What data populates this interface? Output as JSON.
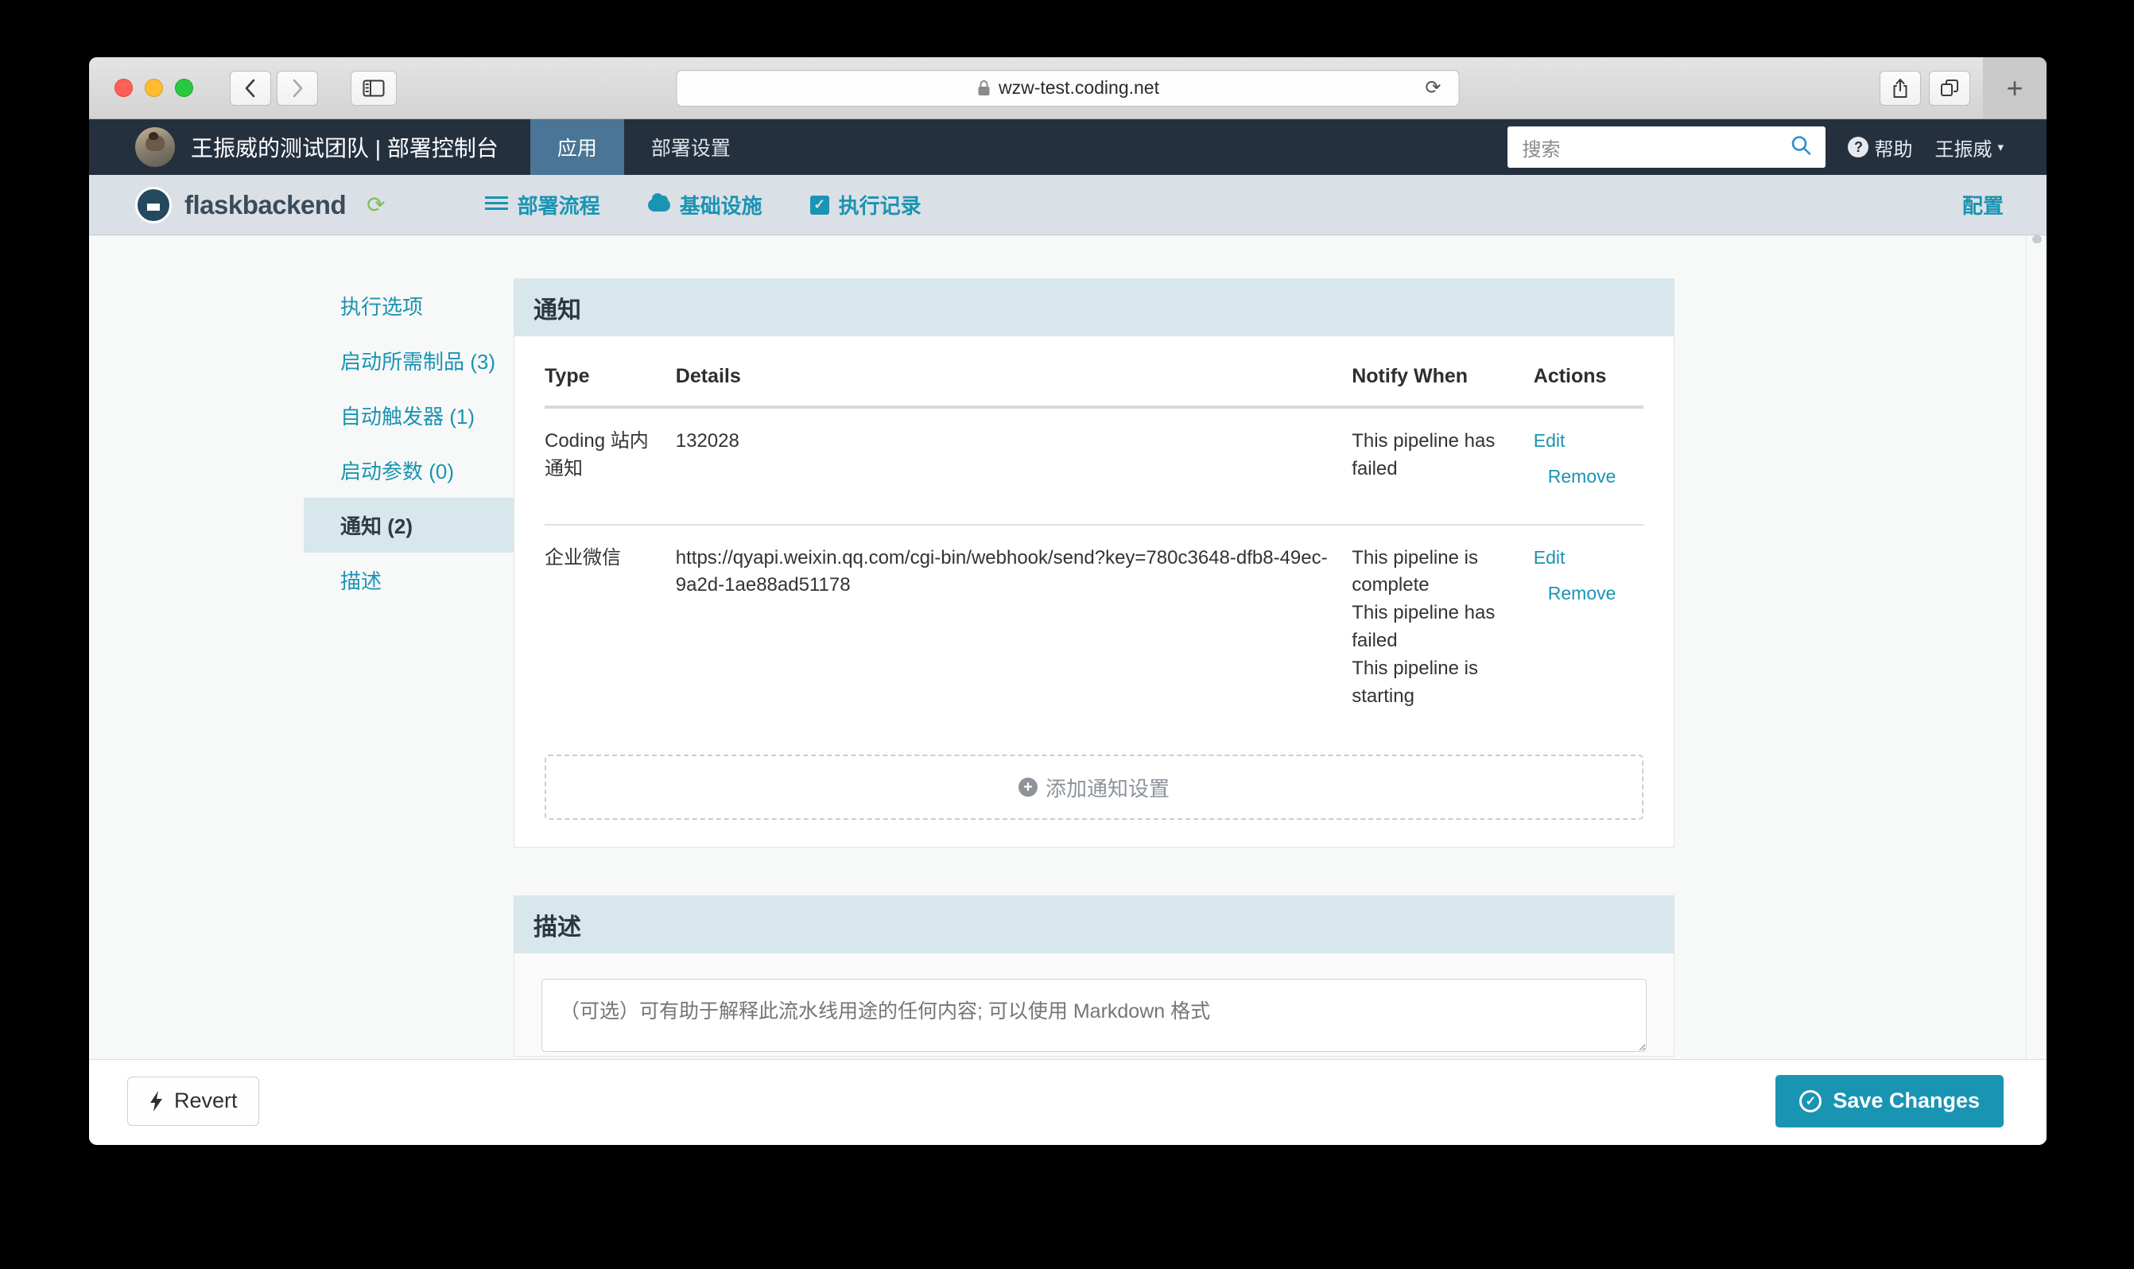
{
  "browser": {
    "url": "wzw-test.coding.net",
    "lock_icon": "lock-icon",
    "back_icon": "chevron-left-icon",
    "forward_icon": "chevron-right-icon",
    "sidebar_icon": "sidebar-toggle-icon",
    "reload_icon": "reload-icon",
    "share_icon": "share-icon",
    "tabs_icon": "tab-overview-icon",
    "newtab_label": "+"
  },
  "topnav": {
    "team_title": "王振威的测试团队 | 部署控制台",
    "items": [
      {
        "label": "应用",
        "active": true
      },
      {
        "label": "部署设置",
        "active": false
      }
    ],
    "search_placeholder": "搜索",
    "search_icon": "search-icon",
    "help_label": "帮助",
    "help_icon": "question-circle-icon",
    "user_label": "王振威",
    "user_caret": "▾",
    "avatar_icon": "avatar"
  },
  "appbar": {
    "app_name": "flaskbackend",
    "sync_icon": "refresh-icon",
    "logo_icon": "app-logo-icon",
    "tabs": [
      {
        "label": "部署流程",
        "icon": "list-icon"
      },
      {
        "label": "基础设施",
        "icon": "cloud-icon"
      },
      {
        "label": "执行记录",
        "icon": "checkbox-icon"
      }
    ],
    "config_label": "配置"
  },
  "sidebar": {
    "items": [
      {
        "label": "执行选项",
        "active": false
      },
      {
        "label": "启动所需制品 (3)",
        "active": false
      },
      {
        "label": "自动触发器 (1)",
        "active": false
      },
      {
        "label": "启动参数 (0)",
        "active": false
      },
      {
        "label": "通知 (2)",
        "active": true
      },
      {
        "label": "描述",
        "active": false
      }
    ]
  },
  "notifications_panel": {
    "title": "通知",
    "columns": [
      "Type",
      "Details",
      "Notify When",
      "Actions"
    ],
    "rows": [
      {
        "type": "Coding 站内通知",
        "details": "132028",
        "notify_when": [
          "This pipeline has failed"
        ],
        "edit_label": "Edit",
        "remove_label": "Remove"
      },
      {
        "type": "企业微信",
        "details": "https://qyapi.weixin.qq.com/cgi-bin/webhook/send?key=780c3648-dfb8-49ec-9a2d-1ae88ad51178",
        "notify_when": [
          "This pipeline is complete",
          "This pipeline has failed",
          "This pipeline is starting"
        ],
        "edit_label": "Edit",
        "remove_label": "Remove"
      }
    ],
    "add_label": "添加通知设置",
    "add_icon": "plus-circle-icon"
  },
  "description_panel": {
    "title": "描述",
    "placeholder": "（可选）可有助于解释此流水线用途的任何内容; 可以使用 Markdown 格式",
    "value": ""
  },
  "actionbar": {
    "revert_label": "Revert",
    "revert_icon": "bolt-icon",
    "save_label": "Save Changes",
    "save_icon": "check-circle-icon"
  },
  "colors": {
    "accent": "#1a94b3",
    "topnav_bg": "#25303f",
    "topnav_active": "#4a7596",
    "appbar_bg": "#dbe0e6",
    "panel_head_bg": "#d7e7ec"
  }
}
